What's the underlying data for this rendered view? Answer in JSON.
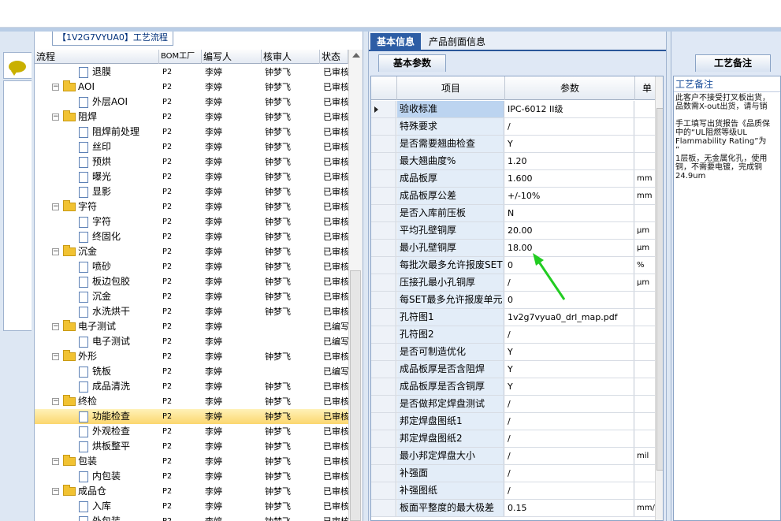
{
  "left_panel": {
    "tab_label": "【1V2G7VYUA0】工艺流程",
    "columns": [
      "流程",
      "BOM工厂",
      "编写人",
      "核审人",
      "状态"
    ],
    "rows": [
      {
        "name": "退膜",
        "level": 2,
        "bom": "P2",
        "writer": "李婷",
        "reviewer": "钟梦飞",
        "status": "已审核"
      },
      {
        "name": "AOI",
        "level": 1,
        "bom": "P2",
        "writer": "李婷",
        "reviewer": "钟梦飞",
        "status": "已审核"
      },
      {
        "name": "外层AOI",
        "level": 2,
        "bom": "P2",
        "writer": "李婷",
        "reviewer": "钟梦飞",
        "status": "已审核"
      },
      {
        "name": "阻焊",
        "level": 1,
        "bom": "P2",
        "writer": "李婷",
        "reviewer": "钟梦飞",
        "status": "已审核"
      },
      {
        "name": "阻焊前处理",
        "level": 2,
        "bom": "P2",
        "writer": "李婷",
        "reviewer": "钟梦飞",
        "status": "已审核"
      },
      {
        "name": "丝印",
        "level": 2,
        "bom": "P2",
        "writer": "李婷",
        "reviewer": "钟梦飞",
        "status": "已审核"
      },
      {
        "name": "预烘",
        "level": 2,
        "bom": "P2",
        "writer": "李婷",
        "reviewer": "钟梦飞",
        "status": "已审核"
      },
      {
        "name": "曝光",
        "level": 2,
        "bom": "P2",
        "writer": "李婷",
        "reviewer": "钟梦飞",
        "status": "已审核"
      },
      {
        "name": "显影",
        "level": 2,
        "bom": "P2",
        "writer": "李婷",
        "reviewer": "钟梦飞",
        "status": "已审核"
      },
      {
        "name": "字符",
        "level": 1,
        "bom": "P2",
        "writer": "李婷",
        "reviewer": "钟梦飞",
        "status": "已审核"
      },
      {
        "name": "字符",
        "level": 2,
        "bom": "P2",
        "writer": "李婷",
        "reviewer": "钟梦飞",
        "status": "已审核"
      },
      {
        "name": "终固化",
        "level": 2,
        "bom": "P2",
        "writer": "李婷",
        "reviewer": "钟梦飞",
        "status": "已审核"
      },
      {
        "name": "沉金",
        "level": 1,
        "bom": "P2",
        "writer": "李婷",
        "reviewer": "钟梦飞",
        "status": "已审核"
      },
      {
        "name": "喷砂",
        "level": 2,
        "bom": "P2",
        "writer": "李婷",
        "reviewer": "钟梦飞",
        "status": "已审核"
      },
      {
        "name": "板边包胶",
        "level": 2,
        "bom": "P2",
        "writer": "李婷",
        "reviewer": "钟梦飞",
        "status": "已审核"
      },
      {
        "name": "沉金",
        "level": 2,
        "bom": "P2",
        "writer": "李婷",
        "reviewer": "钟梦飞",
        "status": "已审核"
      },
      {
        "name": "水洗烘干",
        "level": 2,
        "bom": "P2",
        "writer": "李婷",
        "reviewer": "钟梦飞",
        "status": "已审核"
      },
      {
        "name": "电子测试",
        "level": 1,
        "bom": "P2",
        "writer": "李婷",
        "reviewer": "",
        "status": "已编写"
      },
      {
        "name": "电子测试",
        "level": 2,
        "bom": "P2",
        "writer": "李婷",
        "reviewer": "",
        "status": "已编写"
      },
      {
        "name": "外形",
        "level": 1,
        "bom": "P2",
        "writer": "李婷",
        "reviewer": "钟梦飞",
        "status": "已审核"
      },
      {
        "name": "铣板",
        "level": 2,
        "bom": "P2",
        "writer": "李婷",
        "reviewer": "",
        "status": "已编写"
      },
      {
        "name": "成品清洗",
        "level": 2,
        "bom": "P2",
        "writer": "李婷",
        "reviewer": "钟梦飞",
        "status": "已审核"
      },
      {
        "name": "终检",
        "level": 1,
        "bom": "P2",
        "writer": "李婷",
        "reviewer": "钟梦飞",
        "status": "已审核"
      },
      {
        "name": "功能检查",
        "level": 2,
        "bom": "P2",
        "writer": "李婷",
        "reviewer": "钟梦飞",
        "status": "已审核",
        "selected": true
      },
      {
        "name": "外观检查",
        "level": 2,
        "bom": "P2",
        "writer": "李婷",
        "reviewer": "钟梦飞",
        "status": "已审核"
      },
      {
        "name": "烘板整平",
        "level": 2,
        "bom": "P2",
        "writer": "李婷",
        "reviewer": "钟梦飞",
        "status": "已审核"
      },
      {
        "name": "包装",
        "level": 1,
        "bom": "P2",
        "writer": "李婷",
        "reviewer": "钟梦飞",
        "status": "已审核"
      },
      {
        "name": "内包装",
        "level": 2,
        "bom": "P2",
        "writer": "李婷",
        "reviewer": "钟梦飞",
        "status": "已审核"
      },
      {
        "name": "成品仓",
        "level": 1,
        "bom": "P2",
        "writer": "李婷",
        "reviewer": "钟梦飞",
        "status": "已审核"
      },
      {
        "name": "入库",
        "level": 2,
        "bom": "P2",
        "writer": "李婷",
        "reviewer": "钟梦飞",
        "status": "已审核"
      },
      {
        "name": "外包装",
        "level": 2,
        "bom": "P2",
        "writer": "李婷",
        "reviewer": "钟梦飞",
        "status": "已审核"
      }
    ]
  },
  "middle_panel": {
    "tabs": [
      "基本信息",
      "产品剖面信息"
    ],
    "sub_tab": "基本参数",
    "columns": [
      "项目",
      "参数",
      "单"
    ],
    "rows": [
      {
        "item": "验收标准",
        "value": "IPC-6012 II级",
        "unit": ""
      },
      {
        "item": "特殊要求",
        "value": "/",
        "unit": ""
      },
      {
        "item": "是否需要翘曲检查",
        "value": "Y",
        "unit": ""
      },
      {
        "item": "最大翘曲度%",
        "value": "1.20",
        "unit": ""
      },
      {
        "item": "成品板厚",
        "value": "1.600",
        "unit": "mm"
      },
      {
        "item": "成品板厚公差",
        "value": "+/-10%",
        "unit": "mm"
      },
      {
        "item": "是否入库前压板",
        "value": "N",
        "unit": ""
      },
      {
        "item": "平均孔壁铜厚",
        "value": "20.00",
        "unit": "μm"
      },
      {
        "item": "最小孔壁铜厚",
        "value": "18.00",
        "unit": "μm"
      },
      {
        "item": "每批次最多允许报废SET",
        "value": "0",
        "unit": "%"
      },
      {
        "item": "压接孔最小孔铜厚",
        "value": "/",
        "unit": "μm"
      },
      {
        "item": "每SET最多允许报废单元",
        "value": "0",
        "unit": ""
      },
      {
        "item": "孔符图1",
        "value": "1v2g7vyua0_drl_map.pdf",
        "unit": ""
      },
      {
        "item": "孔符图2",
        "value": "/",
        "unit": ""
      },
      {
        "item": "是否可制造优化",
        "value": "Y",
        "unit": ""
      },
      {
        "item": "成品板厚是否含阻焊",
        "value": "Y",
        "unit": ""
      },
      {
        "item": "成品板厚是否含铜厚",
        "value": "Y",
        "unit": ""
      },
      {
        "item": "是否做邦定焊盘测试",
        "value": "/",
        "unit": ""
      },
      {
        "item": "邦定焊盘图纸1",
        "value": "/",
        "unit": ""
      },
      {
        "item": "邦定焊盘图纸2",
        "value": "/",
        "unit": ""
      },
      {
        "item": "最小邦定焊盘大小",
        "value": "/",
        "unit": "mil"
      },
      {
        "item": "补强面",
        "value": "/",
        "unit": ""
      },
      {
        "item": "补强图纸",
        "value": "/",
        "unit": ""
      },
      {
        "item": "板面平整度的最大极差",
        "value": "0.15",
        "unit": "mm/i"
      }
    ]
  },
  "right_panel": {
    "tab": "工艺备注",
    "header": "工艺备注",
    "note": "此客户不接受打叉板出货，\n品数需X-out出货，请与销\n\n手工填写出货报告《品质保\n中的“UL阻燃等级UL\nFlammability Rating”为\n”\n1层板，无金属化孔，使用\n铜，不需要电镀，完成铜\n24.9um"
  },
  "colors": {
    "accent_blue": "#2d5da5",
    "selected_row": "#fbd66e",
    "annotation_arrow": "#22cc22",
    "folder": "#f1c232"
  }
}
